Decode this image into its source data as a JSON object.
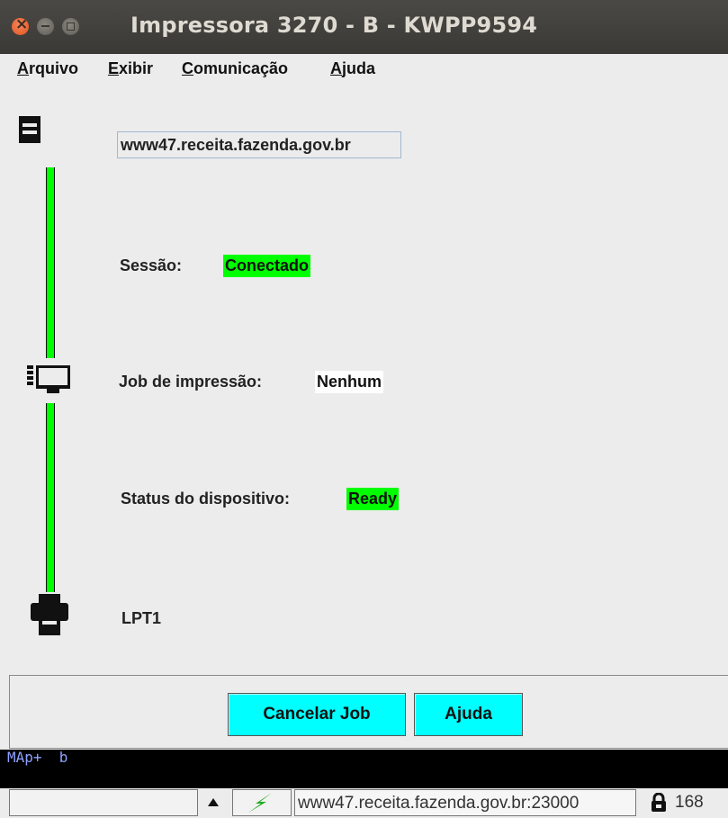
{
  "window": {
    "title": "Impressora 3270 - B - KWPP9594"
  },
  "menu": [
    "Arquivo",
    "Exibir",
    "Comunicação",
    "Ajuda"
  ],
  "host": "www47.receita.fazenda.gov.br",
  "session": {
    "label": "Sessão:",
    "value": "Conectado"
  },
  "job": {
    "label": "Job de impressão:",
    "value": "Nenhum"
  },
  "device_status": {
    "label": "Status do dispositivo:",
    "value": "Ready"
  },
  "printer_port": "LPT1",
  "buttons": {
    "cancel_job": "Cancelar Job",
    "help": "Ajuda"
  },
  "oia": {
    "text": "MAp+  b"
  },
  "statusbar": {
    "field1": "",
    "connection": "www47.receita.fazenda.gov.br:23000",
    "port_num": "168"
  },
  "colors": {
    "connected": "#00ff00",
    "button": "#00ffff",
    "oia_bg": "#000000"
  }
}
